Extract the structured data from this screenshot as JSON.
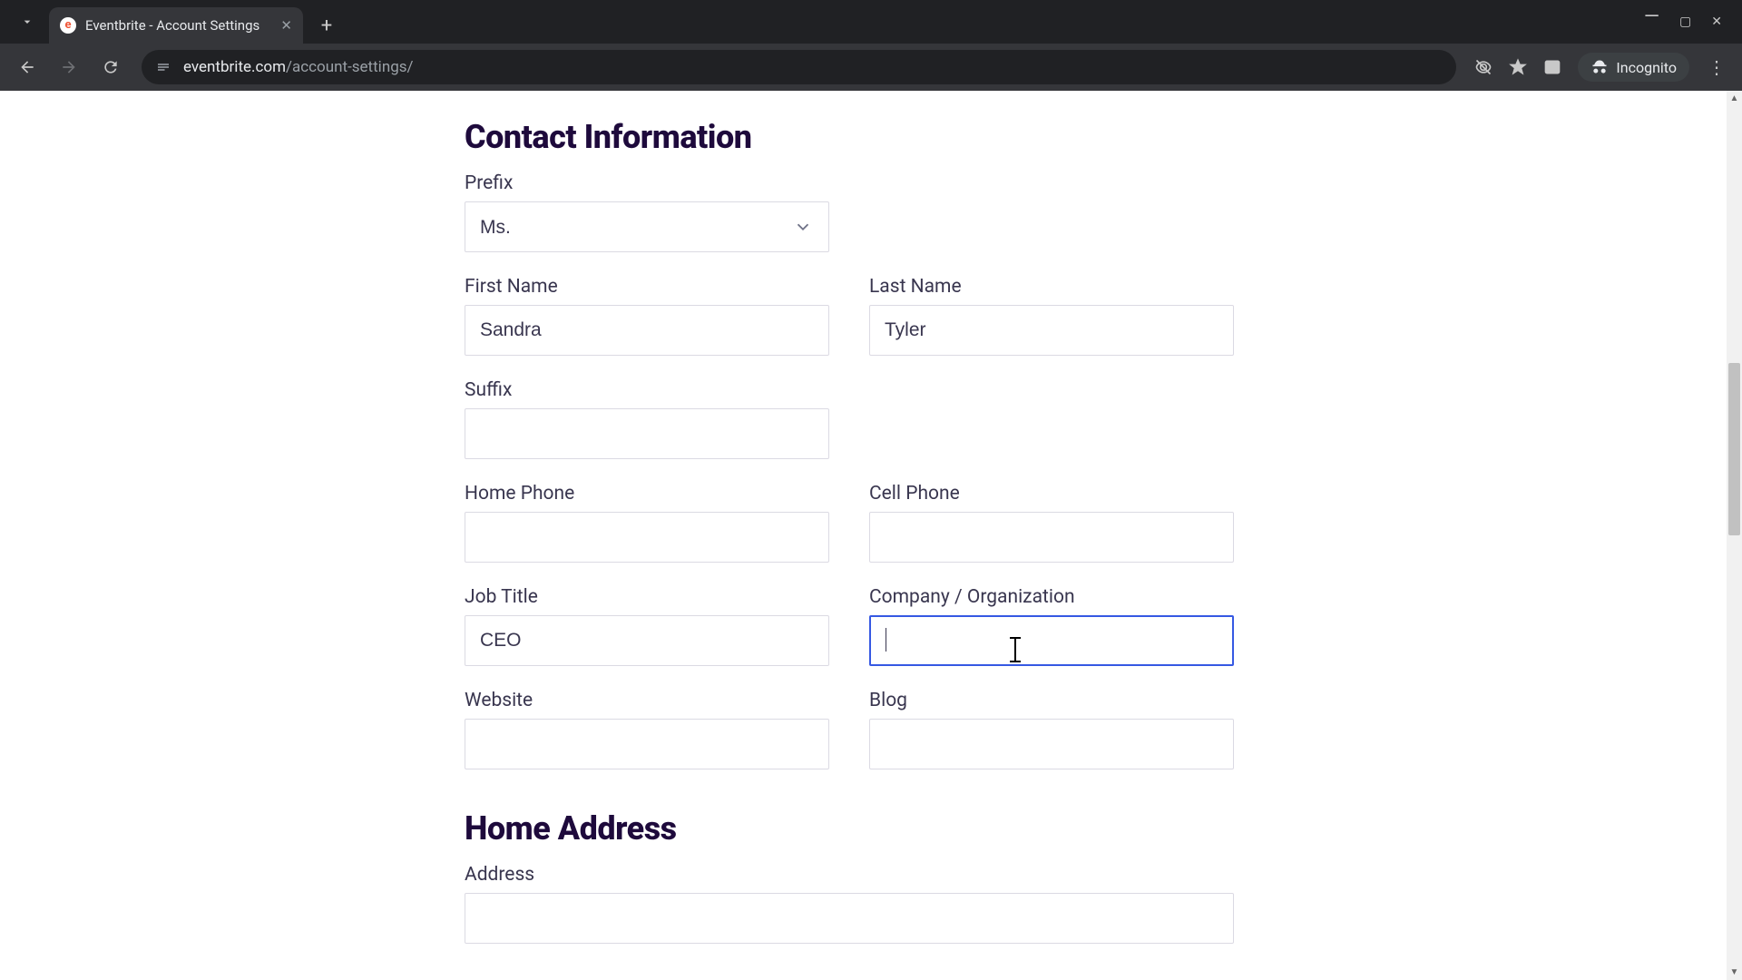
{
  "browser": {
    "tab_title": "Eventbrite - Account Settings",
    "url_host": "eventbrite.com",
    "url_path": "/account-settings/",
    "incognito_label": "Incognito"
  },
  "sections": {
    "contact_heading": "Contact Information",
    "address_heading": "Home Address"
  },
  "labels": {
    "prefix": "Prefix",
    "first_name": "First Name",
    "last_name": "Last Name",
    "suffix": "Suffix",
    "home_phone": "Home Phone",
    "cell_phone": "Cell Phone",
    "job_title": "Job Title",
    "company": "Company / Organization",
    "website": "Website",
    "blog": "Blog",
    "address": "Address"
  },
  "values": {
    "prefix": "Ms.",
    "first_name": "Sandra",
    "last_name": "Tyler",
    "suffix": "",
    "home_phone": "",
    "cell_phone": "",
    "job_title": "CEO",
    "company": "",
    "website": "",
    "blog": "",
    "address": ""
  }
}
